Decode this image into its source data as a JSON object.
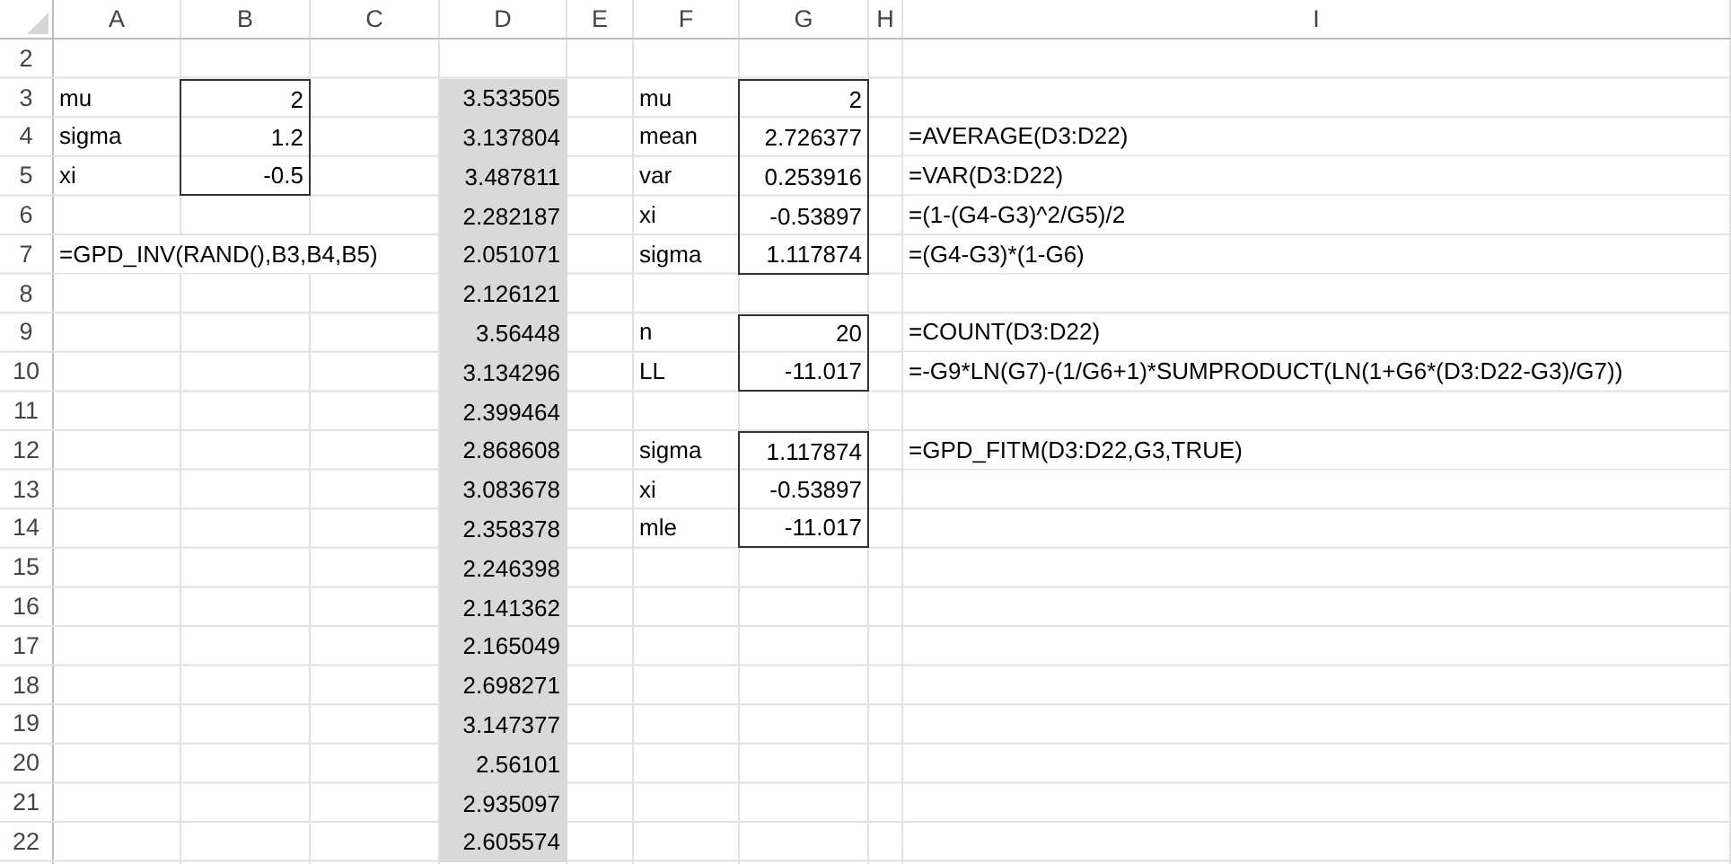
{
  "columns": [
    {
      "label": "A"
    },
    {
      "label": "B"
    },
    {
      "label": "C"
    },
    {
      "label": "D"
    },
    {
      "label": "E"
    },
    {
      "label": "F"
    },
    {
      "label": "G"
    },
    {
      "label": "H"
    },
    {
      "label": "I"
    }
  ],
  "rows": [
    {
      "number": "2",
      "cells": [
        null,
        null,
        null,
        null,
        null,
        null,
        null,
        null,
        null
      ]
    },
    {
      "number": "3",
      "cells": [
        {
          "text": "mu",
          "kind": "label"
        },
        {
          "text": "2",
          "kind": "number",
          "boxed": true,
          "box_top": true,
          "box_bottom": false
        },
        null,
        {
          "text": "3.533505",
          "kind": "number",
          "shaded": true
        },
        null,
        {
          "text": "mu",
          "kind": "label"
        },
        {
          "text": "2",
          "kind": "number",
          "boxed": true,
          "box_top": true,
          "box_bottom": false
        },
        null,
        null
      ]
    },
    {
      "number": "4",
      "cells": [
        {
          "text": "sigma",
          "kind": "label"
        },
        {
          "text": "1.2",
          "kind": "number",
          "boxed": true,
          "box_top": false,
          "box_bottom": false
        },
        null,
        {
          "text": "3.137804",
          "kind": "number",
          "shaded": true
        },
        null,
        {
          "text": "mean",
          "kind": "label"
        },
        {
          "text": "2.726377",
          "kind": "number",
          "boxed": true,
          "box_top": false,
          "box_bottom": false
        },
        null,
        {
          "text": "=AVERAGE(D3:D22)",
          "kind": "formula"
        }
      ]
    },
    {
      "number": "5",
      "cells": [
        {
          "text": "xi",
          "kind": "label"
        },
        {
          "text": "-0.5",
          "kind": "number",
          "boxed": true,
          "box_top": false,
          "box_bottom": true
        },
        null,
        {
          "text": "3.487811",
          "kind": "number",
          "shaded": true
        },
        null,
        {
          "text": "var",
          "kind": "label"
        },
        {
          "text": "0.253916",
          "kind": "number",
          "boxed": true,
          "box_top": false,
          "box_bottom": false
        },
        null,
        {
          "text": "=VAR(D3:D22)",
          "kind": "formula"
        }
      ]
    },
    {
      "number": "6",
      "cells": [
        null,
        null,
        null,
        {
          "text": "2.282187",
          "kind": "number",
          "shaded": true
        },
        null,
        {
          "text": "xi",
          "kind": "label"
        },
        {
          "text": "-0.53897",
          "kind": "number",
          "boxed": true,
          "box_top": false,
          "box_bottom": false
        },
        null,
        {
          "text": "=(1-(G4-G3)^2/G5)/2",
          "kind": "formula"
        }
      ]
    },
    {
      "number": "7",
      "cells": [
        {
          "text": "=GPD_INV(RAND(),B3,B4,B5)",
          "kind": "formula"
        },
        null,
        null,
        {
          "text": "2.051071",
          "kind": "number",
          "shaded": true
        },
        null,
        {
          "text": "sigma",
          "kind": "label"
        },
        {
          "text": "1.117874",
          "kind": "number",
          "boxed": true,
          "box_top": false,
          "box_bottom": true
        },
        null,
        {
          "text": "=(G4-G3)*(1-G6)",
          "kind": "formula"
        }
      ]
    },
    {
      "number": "8",
      "cells": [
        null,
        null,
        null,
        {
          "text": "2.126121",
          "kind": "number",
          "shaded": true
        },
        null,
        null,
        null,
        null,
        null
      ]
    },
    {
      "number": "9",
      "cells": [
        null,
        null,
        null,
        {
          "text": "3.56448",
          "kind": "number",
          "shaded": true
        },
        null,
        {
          "text": "n",
          "kind": "label"
        },
        {
          "text": "20",
          "kind": "number",
          "boxed": true,
          "box_top": true,
          "box_bottom": false
        },
        null,
        {
          "text": "=COUNT(D3:D22)",
          "kind": "formula"
        }
      ]
    },
    {
      "number": "10",
      "cells": [
        null,
        null,
        null,
        {
          "text": "3.134296",
          "kind": "number",
          "shaded": true
        },
        null,
        {
          "text": "LL",
          "kind": "label"
        },
        {
          "text": "-11.017",
          "kind": "number",
          "boxed": true,
          "box_top": false,
          "box_bottom": true
        },
        null,
        {
          "text": "=-G9*LN(G7)-(1/G6+1)*SUMPRODUCT(LN(1+G6*(D3:D22-G3)/G7))",
          "kind": "formula"
        }
      ]
    },
    {
      "number": "11",
      "cells": [
        null,
        null,
        null,
        {
          "text": "2.399464",
          "kind": "number",
          "shaded": true
        },
        null,
        null,
        null,
        null,
        null
      ]
    },
    {
      "number": "12",
      "cells": [
        null,
        null,
        null,
        {
          "text": "2.868608",
          "kind": "number",
          "shaded": true
        },
        null,
        {
          "text": "sigma",
          "kind": "label"
        },
        {
          "text": "1.117874",
          "kind": "number",
          "boxed": true,
          "box_top": true,
          "box_bottom": false
        },
        null,
        {
          "text": "=GPD_FITM(D3:D22,G3,TRUE)",
          "kind": "formula"
        }
      ]
    },
    {
      "number": "13",
      "cells": [
        null,
        null,
        null,
        {
          "text": "3.083678",
          "kind": "number",
          "shaded": true
        },
        null,
        {
          "text": "xi",
          "kind": "label"
        },
        {
          "text": "-0.53897",
          "kind": "number",
          "boxed": true,
          "box_top": false,
          "box_bottom": false
        },
        null,
        null
      ]
    },
    {
      "number": "14",
      "cells": [
        null,
        null,
        null,
        {
          "text": "2.358378",
          "kind": "number",
          "shaded": true
        },
        null,
        {
          "text": "mle",
          "kind": "label"
        },
        {
          "text": "-11.017",
          "kind": "number",
          "boxed": true,
          "box_top": false,
          "box_bottom": true
        },
        null,
        null
      ]
    },
    {
      "number": "15",
      "cells": [
        null,
        null,
        null,
        {
          "text": "2.246398",
          "kind": "number",
          "shaded": true
        },
        null,
        null,
        null,
        null,
        null
      ]
    },
    {
      "number": "16",
      "cells": [
        null,
        null,
        null,
        {
          "text": "2.141362",
          "kind": "number",
          "shaded": true
        },
        null,
        null,
        null,
        null,
        null
      ]
    },
    {
      "number": "17",
      "cells": [
        null,
        null,
        null,
        {
          "text": "2.165049",
          "kind": "number",
          "shaded": true
        },
        null,
        null,
        null,
        null,
        null
      ]
    },
    {
      "number": "18",
      "cells": [
        null,
        null,
        null,
        {
          "text": "2.698271",
          "kind": "number",
          "shaded": true
        },
        null,
        null,
        null,
        null,
        null
      ]
    },
    {
      "number": "19",
      "cells": [
        null,
        null,
        null,
        {
          "text": "3.147377",
          "kind": "number",
          "shaded": true
        },
        null,
        null,
        null,
        null,
        null
      ]
    },
    {
      "number": "20",
      "cells": [
        null,
        null,
        null,
        {
          "text": "2.56101",
          "kind": "number",
          "shaded": true
        },
        null,
        null,
        null,
        null,
        null
      ]
    },
    {
      "number": "21",
      "cells": [
        null,
        null,
        null,
        {
          "text": "2.935097",
          "kind": "number",
          "shaded": true
        },
        null,
        null,
        null,
        null,
        null
      ]
    },
    {
      "number": "22",
      "cells": [
        null,
        null,
        null,
        {
          "text": "2.605574",
          "kind": "number",
          "shaded": true
        },
        null,
        null,
        null,
        null,
        null
      ]
    }
  ]
}
